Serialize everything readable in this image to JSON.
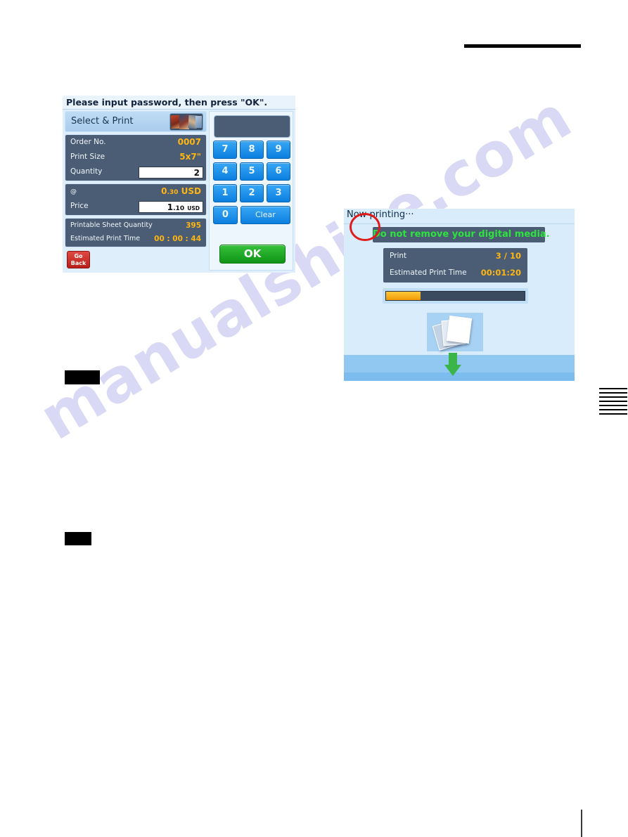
{
  "page": {
    "watermark": "manualshive.com"
  },
  "screen_select_print": {
    "title": "Please input password, then press \"OK\".",
    "header_label": "Select & Print",
    "thumbnail_icon": "photo-collage-icon",
    "rows": [
      {
        "label": "Order No.",
        "value": "0007"
      },
      {
        "label": "Print Size",
        "value": "5x7\""
      },
      {
        "label": "Quantity",
        "value": "2"
      }
    ],
    "price_rows": [
      {
        "label": "@",
        "value": "0",
        "value_small": ".30",
        "unit": "USD"
      },
      {
        "label": "Price",
        "value": "1",
        "value_small": ".10",
        "unit": "USD"
      }
    ],
    "status_rows": [
      {
        "label": "Printable Sheet Quantity",
        "value": "395"
      },
      {
        "label": "Estimated Print Time",
        "value": "00 : 00 : 44"
      }
    ],
    "go_back": {
      "line1": "Go",
      "line2": "Back"
    },
    "display_value": "",
    "keypad": [
      [
        "7",
        "8",
        "9"
      ],
      [
        "4",
        "5",
        "6"
      ],
      [
        "1",
        "2",
        "3"
      ]
    ],
    "keypad_last": {
      "zero": "0",
      "clear": "Clear"
    },
    "ok_label": "OK",
    "colors": {
      "value_orange": "#ffb511",
      "panel_slate": "#4a5d74",
      "key_blue": "#0b7fe0",
      "ok_green": "#119417",
      "go_back_red": "#b81f18"
    }
  },
  "screen_now_printing": {
    "title": "Now printing···",
    "warning": "Do not remove your digital media.",
    "rows": [
      {
        "label": "Print",
        "value": "3 / 10"
      },
      {
        "label": "Estimated Print Time",
        "value": "00:01:20"
      }
    ],
    "progress_percent": 25,
    "document_icon": "stacked-paper-icon",
    "arrow_icon": "down-arrow-icon",
    "annotation_icon": "red-circle-annotation",
    "colors": {
      "warning_green": "#2ee33f",
      "value_orange": "#ffb511",
      "progress_fill": "#f09a06",
      "annotation_red": "#e01b1b"
    }
  }
}
